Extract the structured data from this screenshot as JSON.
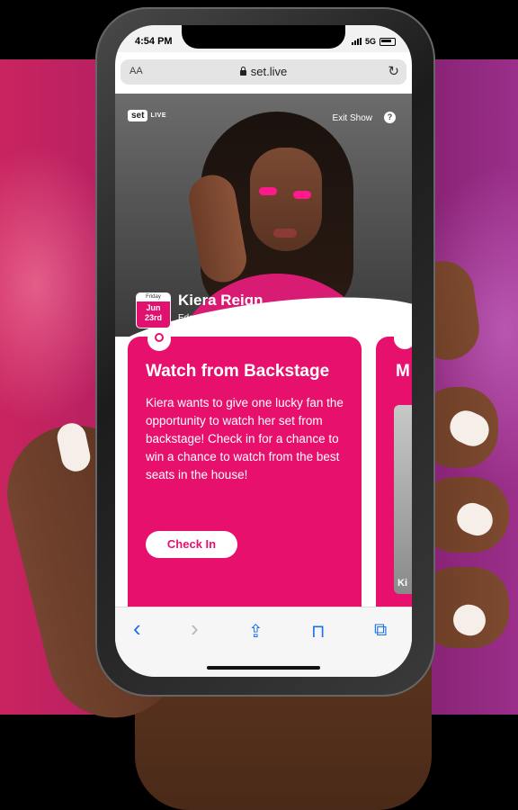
{
  "status_bar": {
    "time": "4:54 PM",
    "network": "5G"
  },
  "browser": {
    "text_size_label": "AA",
    "url": "set.live",
    "reload_glyph": "↻"
  },
  "header": {
    "logo_mark": "set",
    "logo_live": "LIVE",
    "exit_label": "Exit Show",
    "help_label": "?"
  },
  "event": {
    "day": "Friday",
    "month": "Jun",
    "date": "23rd",
    "artist": "Kiera Reign",
    "venue": "Edgewater Amphitheater"
  },
  "cards": [
    {
      "title": "Watch from Backstage",
      "description": "Kiera wants to give one lucky fan the opportunity to watch her set from backstage! Check in for a chance to win a chance to watch from the best seats in the house!",
      "button_label": "Check In",
      "icon": "person-check-icon"
    },
    {
      "title": "M",
      "caption": "Ki",
      "icon": "shirt-icon"
    }
  ],
  "toolbar": {
    "back_glyph": "‹",
    "forward_glyph": "›",
    "share_glyph": "⇪",
    "bookmarks_glyph": "⊓",
    "tabs_glyph": "⧉"
  },
  "colors": {
    "accent": "#e8106d",
    "safari_blue": "#1a73e8"
  }
}
